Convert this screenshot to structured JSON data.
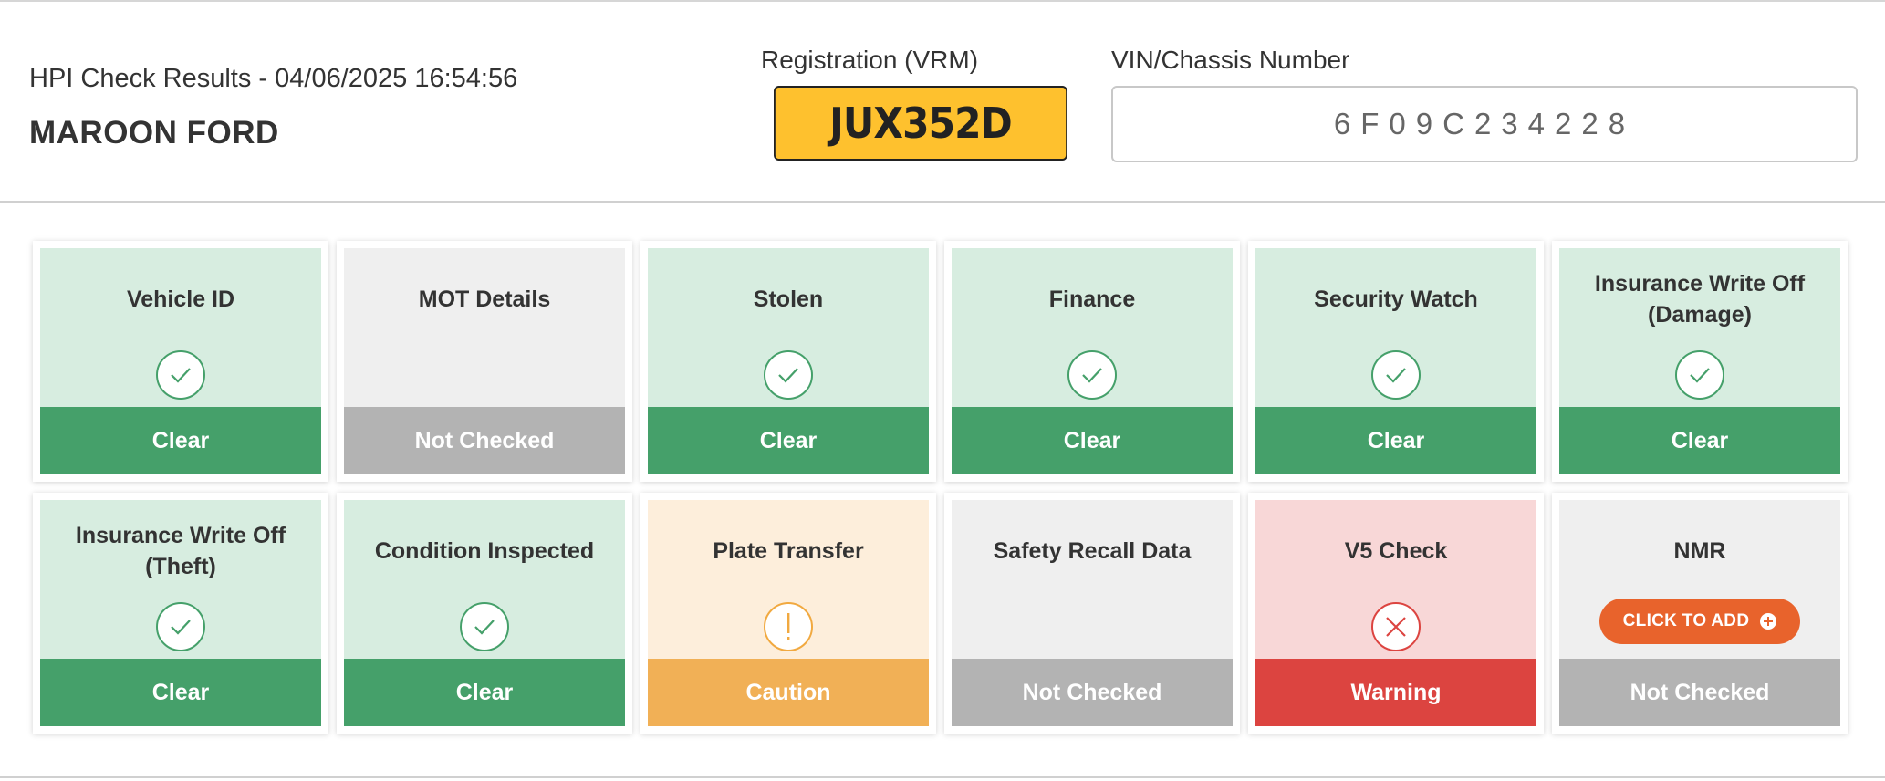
{
  "header": {
    "check_title": "HPI Check Results - 04/06/2025 16:54:56",
    "vehicle_name": "MAROON FORD",
    "vrm_label": "Registration (VRM)",
    "vrm_value": "JUX352D",
    "vin_label": "VIN/Chassis Number",
    "vin_value": "6F09C234228"
  },
  "colors": {
    "clear_bg": "#d7ede0",
    "clear_bar": "#45a06a",
    "not_checked_bg": "#efefef",
    "not_checked_bar": "#b3b3b3",
    "caution_bg": "#fdeedb",
    "caution_bar": "#f1b056",
    "warning_bg": "#f8d7d7",
    "warning_bar": "#dc4440",
    "plate": "#fec12e",
    "add_button": "#e8632c"
  },
  "checks": [
    {
      "title": "Vehicle ID",
      "status": "Clear",
      "icon": "check-icon"
    },
    {
      "title": "MOT Details",
      "status": "Not Checked",
      "icon": ""
    },
    {
      "title": "Stolen",
      "status": "Clear",
      "icon": "check-icon"
    },
    {
      "title": "Finance",
      "status": "Clear",
      "icon": "check-icon"
    },
    {
      "title": "Security Watch",
      "status": "Clear",
      "icon": "check-icon"
    },
    {
      "title": "Insurance Write Off (Damage)",
      "status": "Clear",
      "icon": "check-icon"
    },
    {
      "title": "Insurance Write Off (Theft)",
      "status": "Clear",
      "icon": "check-icon"
    },
    {
      "title": "Condition Inspected",
      "status": "Clear",
      "icon": "check-icon"
    },
    {
      "title": "Plate Transfer",
      "status": "Caution",
      "icon": "exclamation-icon"
    },
    {
      "title": "Safety Recall Data",
      "status": "Not Checked",
      "icon": ""
    },
    {
      "title": "V5 Check",
      "status": "Warning",
      "icon": "cross-icon"
    },
    {
      "title": "NMR",
      "status": "Not Checked",
      "icon": "plus-icon",
      "button_label": "CLICK TO ADD"
    }
  ]
}
